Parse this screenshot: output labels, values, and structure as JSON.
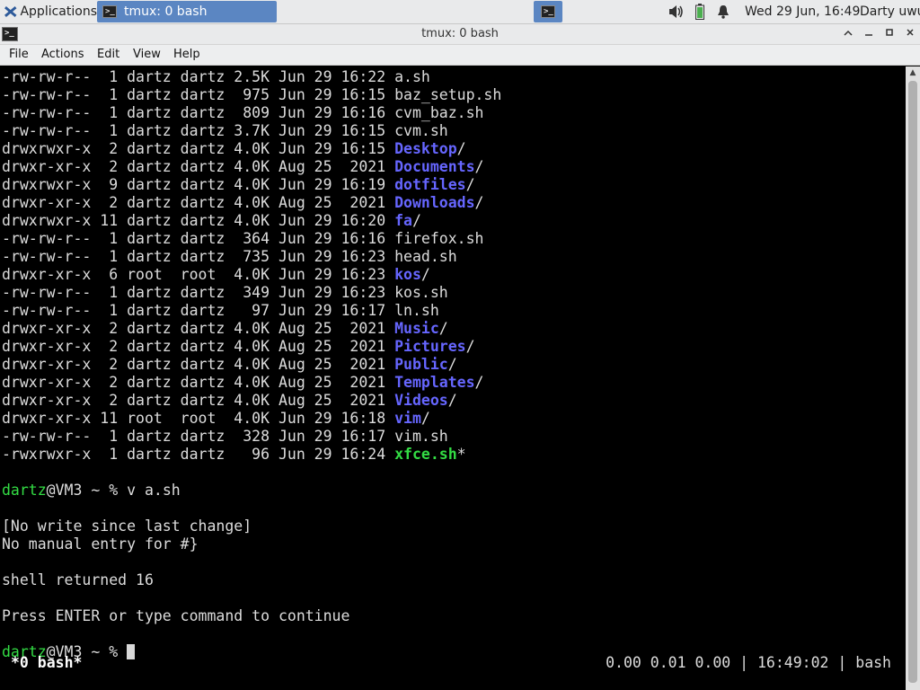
{
  "panel": {
    "applications_label": "Applications",
    "task_label": "tmux: 0 bash",
    "clock": "Wed 29 Jun, 16:49",
    "user": "Darty uwu"
  },
  "window": {
    "title": "tmux: 0 bash"
  },
  "menu": {
    "file": "File",
    "actions": "Actions",
    "edit": "Edit",
    "view": "View",
    "help": "Help"
  },
  "listing": [
    {
      "perms": "-rw-rw-r--  1 dartz dartz 2.5K Jun 29 16:22 ",
      "name": "a.sh",
      "kind": "file",
      "suffix": ""
    },
    {
      "perms": "-rw-rw-r--  1 dartz dartz  975 Jun 29 16:15 ",
      "name": "baz_setup.sh",
      "kind": "file",
      "suffix": ""
    },
    {
      "perms": "-rw-rw-r--  1 dartz dartz  809 Jun 29 16:16 ",
      "name": "cvm_baz.sh",
      "kind": "file",
      "suffix": ""
    },
    {
      "perms": "-rw-rw-r--  1 dartz dartz 3.7K Jun 29 16:15 ",
      "name": "cvm.sh",
      "kind": "file",
      "suffix": ""
    },
    {
      "perms": "drwxrwxr-x  2 dartz dartz 4.0K Jun 29 16:15 ",
      "name": "Desktop",
      "kind": "dir",
      "suffix": "/"
    },
    {
      "perms": "drwxr-xr-x  2 dartz dartz 4.0K Aug 25  2021 ",
      "name": "Documents",
      "kind": "dir",
      "suffix": "/"
    },
    {
      "perms": "drwxrwxr-x  9 dartz dartz 4.0K Jun 29 16:19 ",
      "name": "dotfiles",
      "kind": "dir",
      "suffix": "/"
    },
    {
      "perms": "drwxr-xr-x  2 dartz dartz 4.0K Aug 25  2021 ",
      "name": "Downloads",
      "kind": "dir",
      "suffix": "/"
    },
    {
      "perms": "drwxrwxr-x 11 dartz dartz 4.0K Jun 29 16:20 ",
      "name": "fa",
      "kind": "dir",
      "suffix": "/"
    },
    {
      "perms": "-rw-rw-r--  1 dartz dartz  364 Jun 29 16:16 ",
      "name": "firefox.sh",
      "kind": "file",
      "suffix": ""
    },
    {
      "perms": "-rw-rw-r--  1 dartz dartz  735 Jun 29 16:23 ",
      "name": "head.sh",
      "kind": "file",
      "suffix": ""
    },
    {
      "perms": "drwxr-xr-x  6 root  root  4.0K Jun 29 16:23 ",
      "name": "kos",
      "kind": "dir",
      "suffix": "/"
    },
    {
      "perms": "-rw-rw-r--  1 dartz dartz  349 Jun 29 16:23 ",
      "name": "kos.sh",
      "kind": "file",
      "suffix": ""
    },
    {
      "perms": "-rw-rw-r--  1 dartz dartz   97 Jun 29 16:17 ",
      "name": "ln.sh",
      "kind": "file",
      "suffix": ""
    },
    {
      "perms": "drwxr-xr-x  2 dartz dartz 4.0K Aug 25  2021 ",
      "name": "Music",
      "kind": "dir",
      "suffix": "/"
    },
    {
      "perms": "drwxr-xr-x  2 dartz dartz 4.0K Aug 25  2021 ",
      "name": "Pictures",
      "kind": "dir",
      "suffix": "/"
    },
    {
      "perms": "drwxr-xr-x  2 dartz dartz 4.0K Aug 25  2021 ",
      "name": "Public",
      "kind": "dir",
      "suffix": "/"
    },
    {
      "perms": "drwxr-xr-x  2 dartz dartz 4.0K Aug 25  2021 ",
      "name": "Templates",
      "kind": "dir",
      "suffix": "/"
    },
    {
      "perms": "drwxr-xr-x  2 dartz dartz 4.0K Aug 25  2021 ",
      "name": "Videos",
      "kind": "dir",
      "suffix": "/"
    },
    {
      "perms": "drwxr-xr-x 11 root  root  4.0K Jun 29 16:18 ",
      "name": "vim",
      "kind": "dir",
      "suffix": "/"
    },
    {
      "perms": "-rw-rw-r--  1 dartz dartz  328 Jun 29 16:17 ",
      "name": "vim.sh",
      "kind": "file",
      "suffix": ""
    },
    {
      "perms": "-rwxrwxr-x  1 dartz dartz   96 Jun 29 16:24 ",
      "name": "xfce.sh",
      "kind": "exe",
      "suffix": "*"
    }
  ],
  "session": {
    "prompt_user": "dartz",
    "prompt_rest": "@VM3 ~ % ",
    "command": "v a.sh",
    "msg1": "[No write since last change]",
    "msg2": "No manual entry for #}",
    "msg3": "shell returned 16",
    "msg4": "Press ENTER or type command to continue"
  },
  "status": {
    "window_label": "*0 bash*",
    "right": "0.00 0.01 0.00 | 16:49:02 | bash"
  },
  "colors": {
    "directory": "#6666ff",
    "executable": "#33dd44",
    "panel_accent": "#5b86c2"
  }
}
